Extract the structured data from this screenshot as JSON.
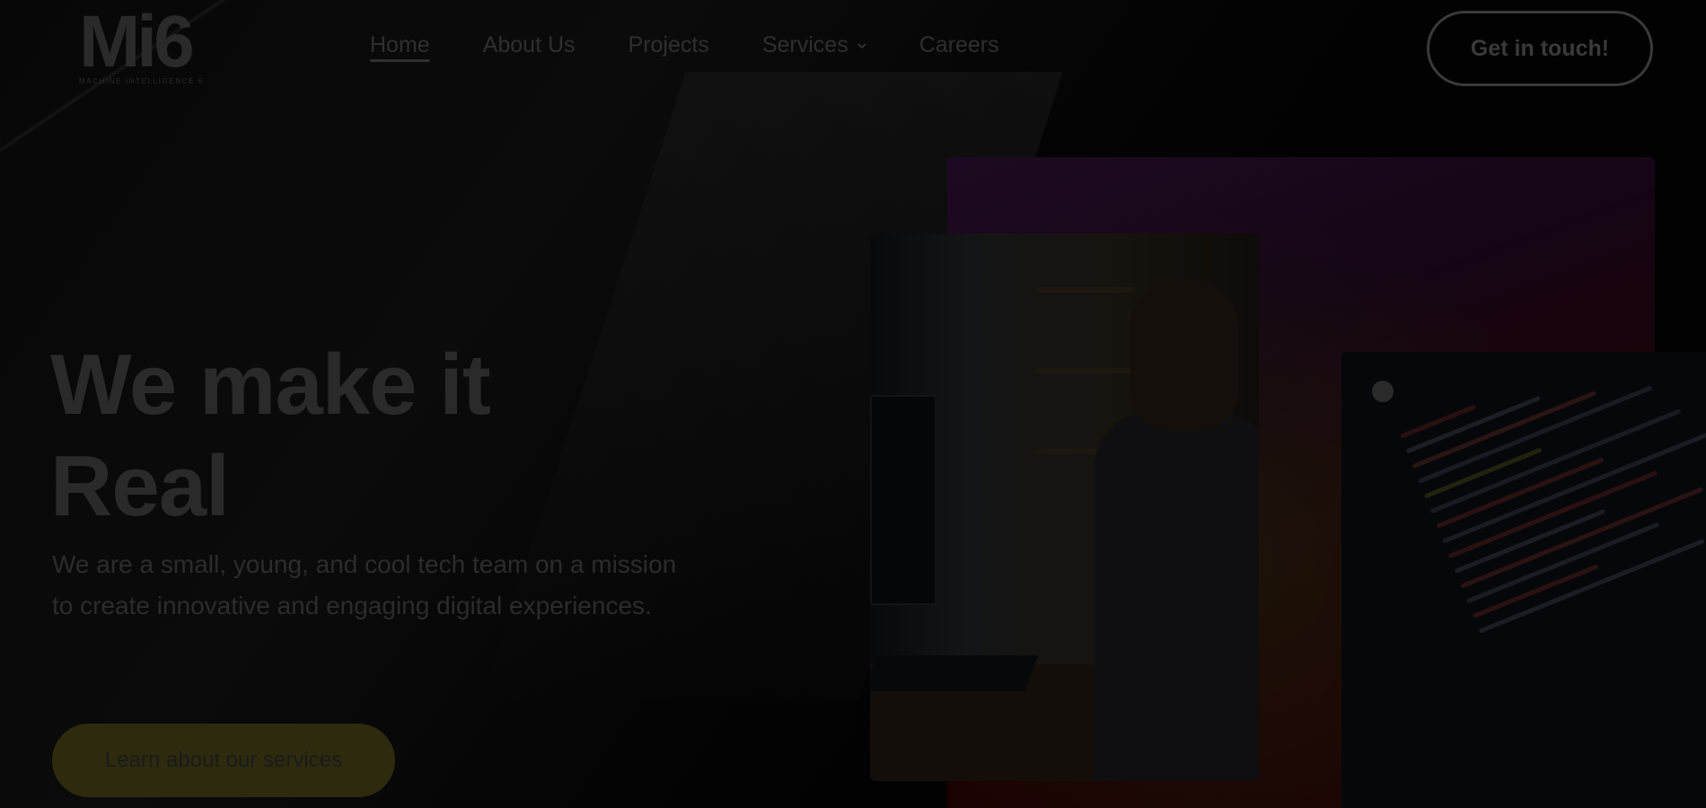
{
  "brand": {
    "logo": "Mi6",
    "tagline": "MACHINE INTELLIGENCE 6"
  },
  "nav": {
    "items": [
      {
        "label": "Home"
      },
      {
        "label": "About Us"
      },
      {
        "label": "Projects"
      },
      {
        "label": "Services"
      },
      {
        "label": "Careers"
      }
    ],
    "cta": "Get in touch!"
  },
  "hero": {
    "title_line1": "We make it",
    "title_line2": "Real",
    "subtitle": "We are a small, young, and cool tech team on a mission to create innovative and engaging digital experiences.",
    "cta": "Learn about our services"
  },
  "colors": {
    "background": "#000000",
    "cta_fill": "#2d2a0e",
    "gradient_start": "#1d0a22",
    "gradient_end": "#1a0000"
  },
  "icons": [
    "chevron-down-icon",
    "brain-icon"
  ]
}
